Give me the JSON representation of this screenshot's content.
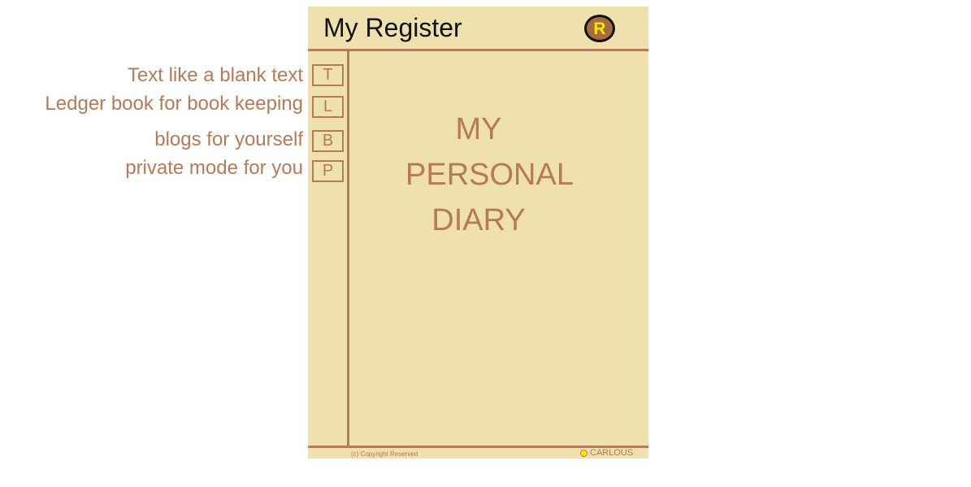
{
  "side_labels": {
    "text": "Text like a blank text",
    "ledger": "Ledger book for book keeping",
    "blogs": "blogs for yourself",
    "private": "private mode for you"
  },
  "header": {
    "title": "My Register",
    "logo_letter": "R"
  },
  "nav": {
    "text": "T",
    "ledger": "L",
    "blogs": "B",
    "private": "P"
  },
  "main": {
    "title_line1": "MY",
    "title_line2": "PERSONAL",
    "title_line3": "DIARY"
  },
  "footer": {
    "copyright": "(c) Copyright Reserved",
    "brand": "CARLOUS"
  },
  "colors": {
    "background": "#efe1ad",
    "accent": "#b57a58",
    "logo_fill": "#a66b3c",
    "logo_letter": "#ffe500"
  }
}
